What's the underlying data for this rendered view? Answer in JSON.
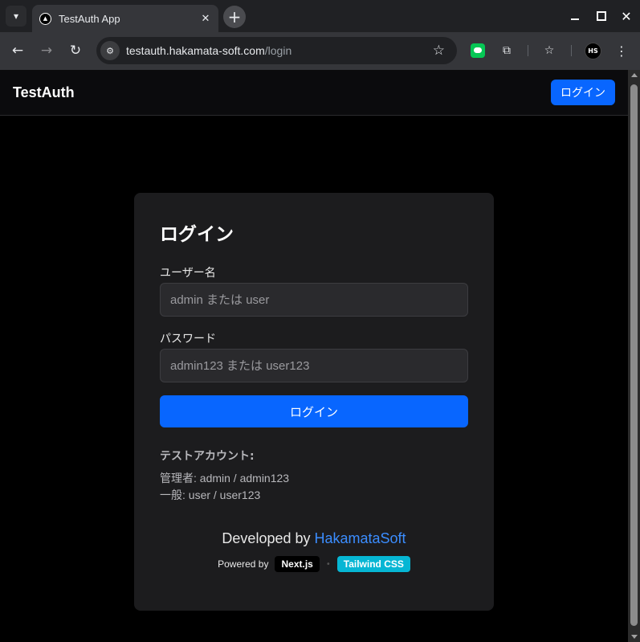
{
  "browser": {
    "tab_title": "TestAuth App",
    "url_host": "testauth.hakamata-soft.com",
    "url_path": "/login",
    "profile_initials": "HS",
    "icons": [
      "tab-search-icon",
      "app-favicon-icon",
      "close-icon",
      "new-tab-icon",
      "minimize-icon",
      "maximize-icon",
      "window-close-icon",
      "back-icon",
      "forward-icon",
      "reload-icon",
      "site-info-icon",
      "star-icon",
      "line-extension-icon",
      "puzzle-icon",
      "bookmarks-icon",
      "kebab-menu-icon"
    ]
  },
  "header": {
    "brand": "TestAuth",
    "login_button": "ログイン"
  },
  "login_card": {
    "title": "ログイン",
    "username_label": "ユーザー名",
    "username_placeholder": "admin または user",
    "username_value": "",
    "password_label": "パスワード",
    "password_placeholder": "admin123 または user123",
    "password_value": "",
    "submit_label": "ログイン"
  },
  "test_accounts": {
    "title": "テストアカウント:",
    "admin_line": "管理者: admin / admin123",
    "general_line": "一般: user / user123"
  },
  "footer": {
    "developed_by": "Developed by ",
    "developer": "HakamataSoft",
    "powered_by": "Powered by",
    "badge_next": "Next.js",
    "badge_tailwind": "Tailwind CSS"
  },
  "colors": {
    "accent": "#0866ff",
    "link": "#3b8dff",
    "tailwind_badge": "#06b6d4",
    "card_bg": "#1c1c1e"
  }
}
